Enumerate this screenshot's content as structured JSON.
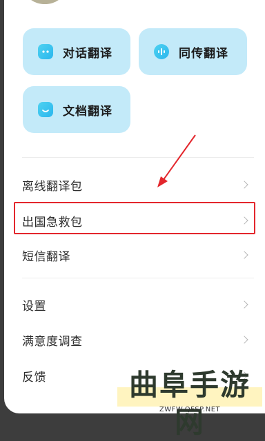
{
  "feature_tiles": [
    {
      "label": "对话翻译",
      "icon": "chat-bubble-icon"
    },
    {
      "label": "同传翻译",
      "icon": "voice-wave-icon"
    },
    {
      "label": "文档翻译",
      "icon": "document-icon"
    }
  ],
  "menu_group_1": [
    {
      "label": "离线翻译包"
    },
    {
      "label": "出国急救包"
    },
    {
      "label": "短信翻译"
    }
  ],
  "menu_group_2": [
    {
      "label": "设置"
    },
    {
      "label": "满意度调查"
    },
    {
      "label": "反馈"
    }
  ],
  "watermark": {
    "title": "曲阜手游网",
    "url": "ZWFW.QFSP.NET"
  },
  "colors": {
    "tile_bg": "#c3eaf9",
    "icon_accent": "#2ab6ee",
    "annotation_red": "#e3262c"
  }
}
